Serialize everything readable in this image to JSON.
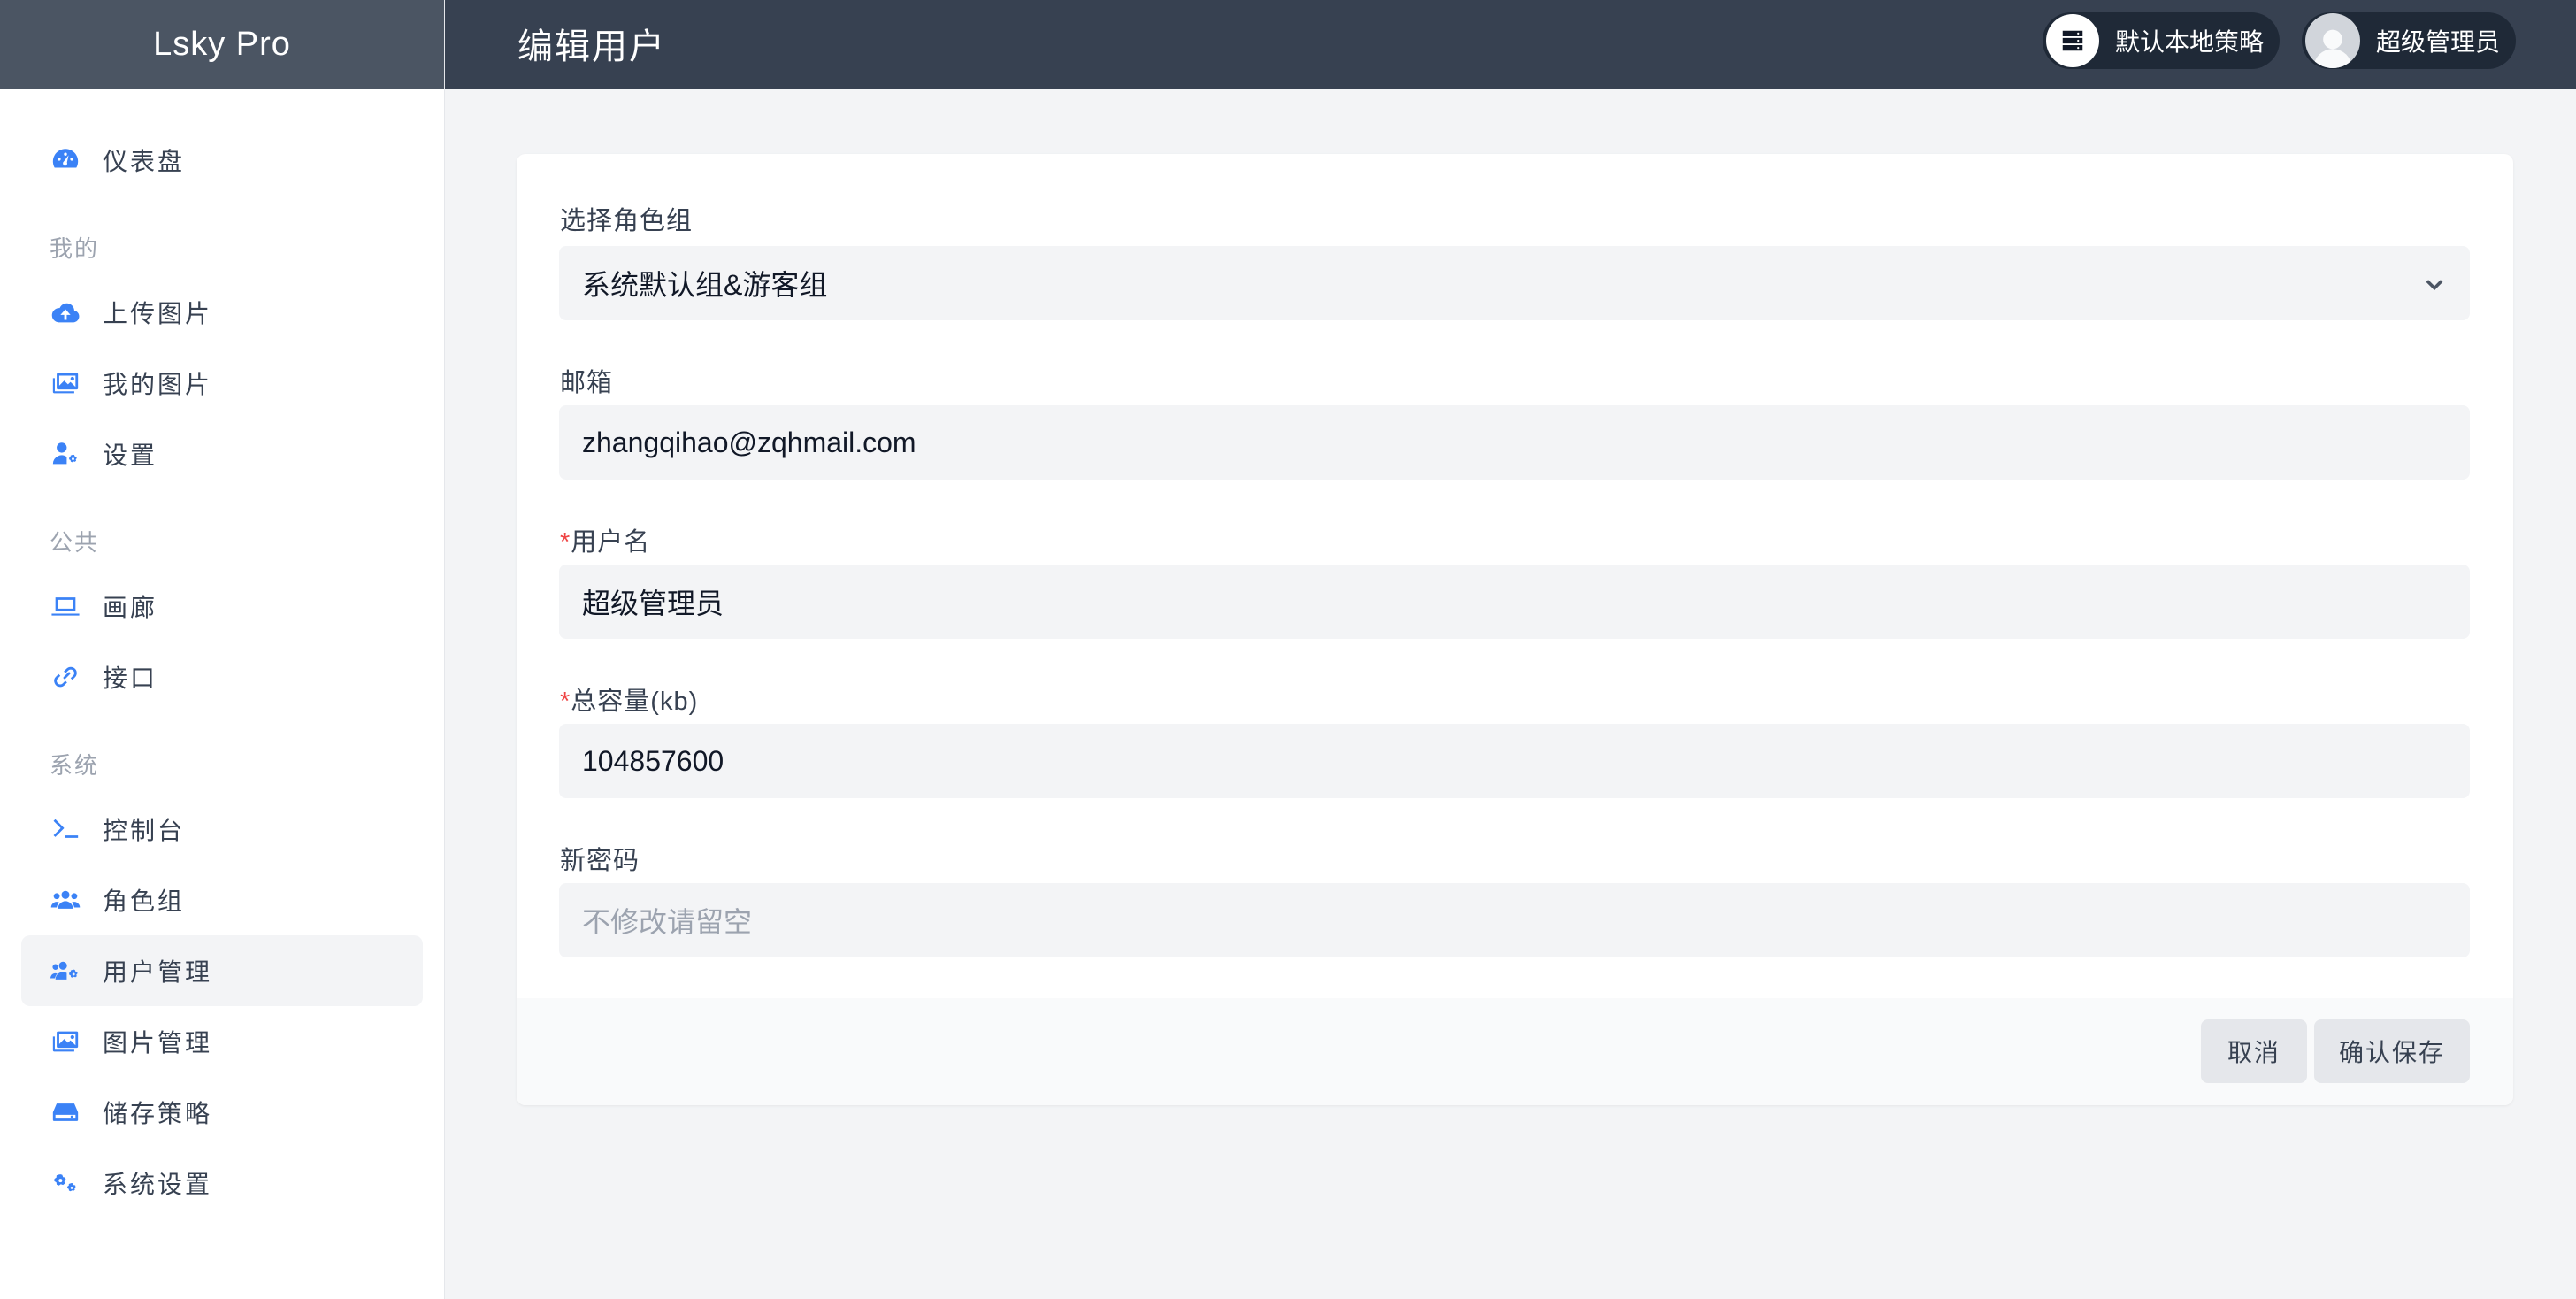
{
  "brand": "Lsky Pro",
  "page_title": "编辑用户",
  "header": {
    "strategy_label": "默认本地策略",
    "user_label": "超级管理员"
  },
  "sidebar": {
    "dashboard": "仪表盘",
    "section_mine": "我的",
    "upload": "上传图片",
    "my_images": "我的图片",
    "settings": "设置",
    "section_public": "公共",
    "gallery": "画廊",
    "api": "接口",
    "section_system": "系统",
    "console": "控制台",
    "roles": "角色组",
    "users": "用户管理",
    "images": "图片管理",
    "storage": "储存策略",
    "system_settings": "系统设置"
  },
  "form": {
    "role_label": "选择角色组",
    "role_value": "系统默认组&游客组",
    "email_label": "邮箱",
    "email_value": "zhangqihao@zqhmail.com",
    "required_mark": "*",
    "username_label": "用户名",
    "username_value": "超级管理员",
    "capacity_label": "总容量(kb)",
    "capacity_value": "104857600",
    "password_label": "新密码",
    "password_placeholder": "不修改请留空"
  },
  "actions": {
    "cancel": "取消",
    "save": "确认保存"
  },
  "colors": {
    "accent": "#3b82f6",
    "topbar": "#374151",
    "brand_bg": "#4b5563",
    "required": "#ef4444"
  }
}
